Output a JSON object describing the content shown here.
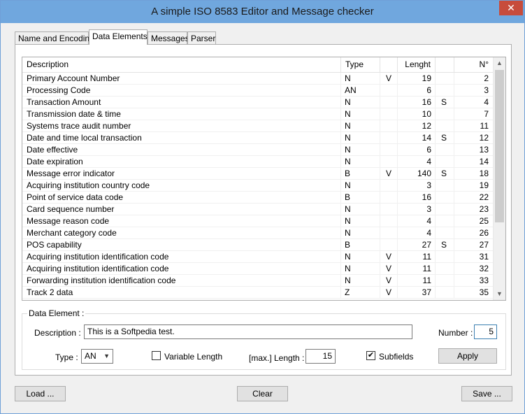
{
  "window": {
    "title": "A simple ISO 8583 Editor and Message checker",
    "close": "✕"
  },
  "tabs": [
    "Name and Encoding",
    "Data Elements",
    "Messages",
    "Parser"
  ],
  "grid": {
    "headers": {
      "description": "Description",
      "type": "Type",
      "length": "Lenght",
      "number": "N°"
    },
    "rows": [
      {
        "description": "Primary Account Number",
        "type": "N",
        "variable": "V",
        "length": "19",
        "sub": "",
        "number": "2"
      },
      {
        "description": "Processing Code",
        "type": "AN",
        "variable": "",
        "length": "6",
        "sub": "",
        "number": "3"
      },
      {
        "description": "Transaction Amount",
        "type": "N",
        "variable": "",
        "length": "16",
        "sub": "S",
        "number": "4"
      },
      {
        "description": "Transmission date & time",
        "type": "N",
        "variable": "",
        "length": "10",
        "sub": "",
        "number": "7"
      },
      {
        "description": "Systems trace audit number",
        "type": "N",
        "variable": "",
        "length": "12",
        "sub": "",
        "number": "11"
      },
      {
        "description": "Date and time local transaction",
        "type": "N",
        "variable": "",
        "length": "14",
        "sub": "S",
        "number": "12"
      },
      {
        "description": "Date effective",
        "type": "N",
        "variable": "",
        "length": "6",
        "sub": "",
        "number": "13"
      },
      {
        "description": "Date expiration",
        "type": "N",
        "variable": "",
        "length": "4",
        "sub": "",
        "number": "14"
      },
      {
        "description": "Message error indicator",
        "type": "B",
        "variable": "V",
        "length": "140",
        "sub": "S",
        "number": "18"
      },
      {
        "description": "Acquiring institution country code",
        "type": "N",
        "variable": "",
        "length": "3",
        "sub": "",
        "number": "19"
      },
      {
        "description": "Point of service data code",
        "type": "B",
        "variable": "",
        "length": "16",
        "sub": "",
        "number": "22"
      },
      {
        "description": "Card sequence number",
        "type": "N",
        "variable": "",
        "length": "3",
        "sub": "",
        "number": "23"
      },
      {
        "description": "Message reason code",
        "type": "N",
        "variable": "",
        "length": "4",
        "sub": "",
        "number": "25"
      },
      {
        "description": "Merchant category code",
        "type": "N",
        "variable": "",
        "length": "4",
        "sub": "",
        "number": "26"
      },
      {
        "description": "POS capability",
        "type": "B",
        "variable": "",
        "length": "27",
        "sub": "S",
        "number": "27"
      },
      {
        "description": "Acquiring institution identification code",
        "type": "N",
        "variable": "V",
        "length": "11",
        "sub": "",
        "number": "31"
      },
      {
        "description": "Acquiring institution identification code",
        "type": "N",
        "variable": "V",
        "length": "11",
        "sub": "",
        "number": "32"
      },
      {
        "description": "Forwarding institution identification code",
        "type": "N",
        "variable": "V",
        "length": "11",
        "sub": "",
        "number": "33"
      },
      {
        "description": "Track 2 data",
        "type": "Z",
        "variable": "V",
        "length": "37",
        "sub": "",
        "number": "35"
      }
    ]
  },
  "element": {
    "group_title": "Data Element :",
    "description_label": "Description :",
    "description_value": "This is a Softpedia test.",
    "number_label": "Number :",
    "number_value": "5",
    "type_label": "Type :",
    "type_value": "AN",
    "variable_length_label": "Variable Length",
    "variable_length_checked": false,
    "max_length_label": "[max.] Length :",
    "max_length_value": "15",
    "subfields_label": "Subfields",
    "subfields_checked": true,
    "apply_label": "Apply"
  },
  "footer": {
    "load": "Load ...",
    "clear": "Clear",
    "save": "Save ..."
  },
  "icons": {
    "check": "✔",
    "arrow_up": "▲",
    "arrow_down": "▼"
  }
}
